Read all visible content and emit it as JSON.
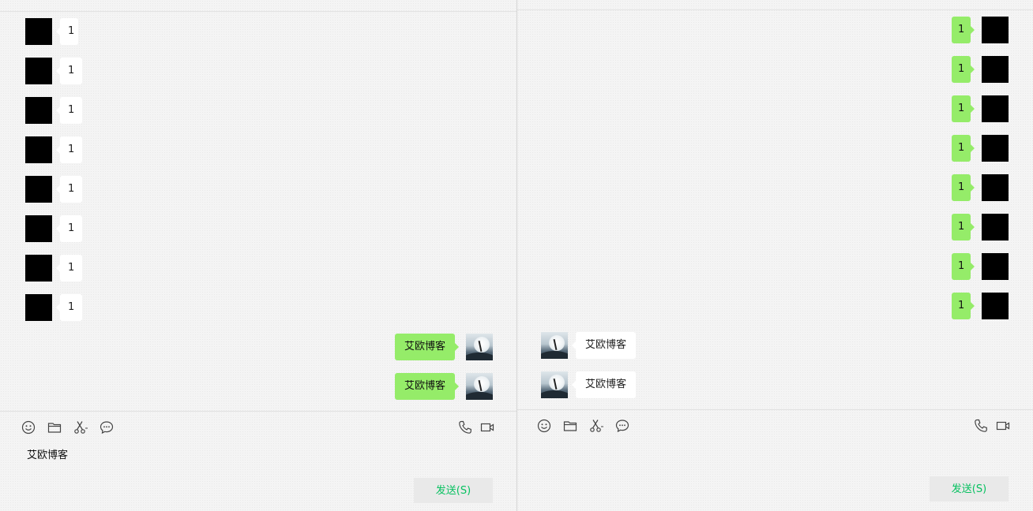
{
  "colors": {
    "background": "#f4f4f4",
    "self_bubble": "#95ec69",
    "other_bubble": "#ffffff",
    "send_text": "#07c160",
    "divider": "#d3d3d3"
  },
  "left_window": {
    "received_messages": [
      "1",
      "1",
      "1",
      "1",
      "1",
      "1",
      "1",
      "1"
    ],
    "sent_messages": [
      "艾欧博客",
      "艾欧博客"
    ],
    "toolbar_icons": [
      "emoji-icon",
      "folder-icon",
      "scissors-icon",
      "chat-bubble-icon",
      "phone-icon",
      "video-icon"
    ],
    "input_text": "艾欧博客",
    "send_label": "发送(S)"
  },
  "right_window": {
    "sent_messages": [
      "1",
      "1",
      "1",
      "1",
      "1",
      "1",
      "1",
      "1"
    ],
    "received_messages": [
      "艾欧博客",
      "艾欧博客"
    ],
    "toolbar_icons": [
      "emoji-icon",
      "folder-icon",
      "scissors-icon",
      "chat-bubble-icon",
      "phone-icon",
      "video-icon"
    ],
    "input_text": "",
    "send_label": "发送(S)"
  }
}
